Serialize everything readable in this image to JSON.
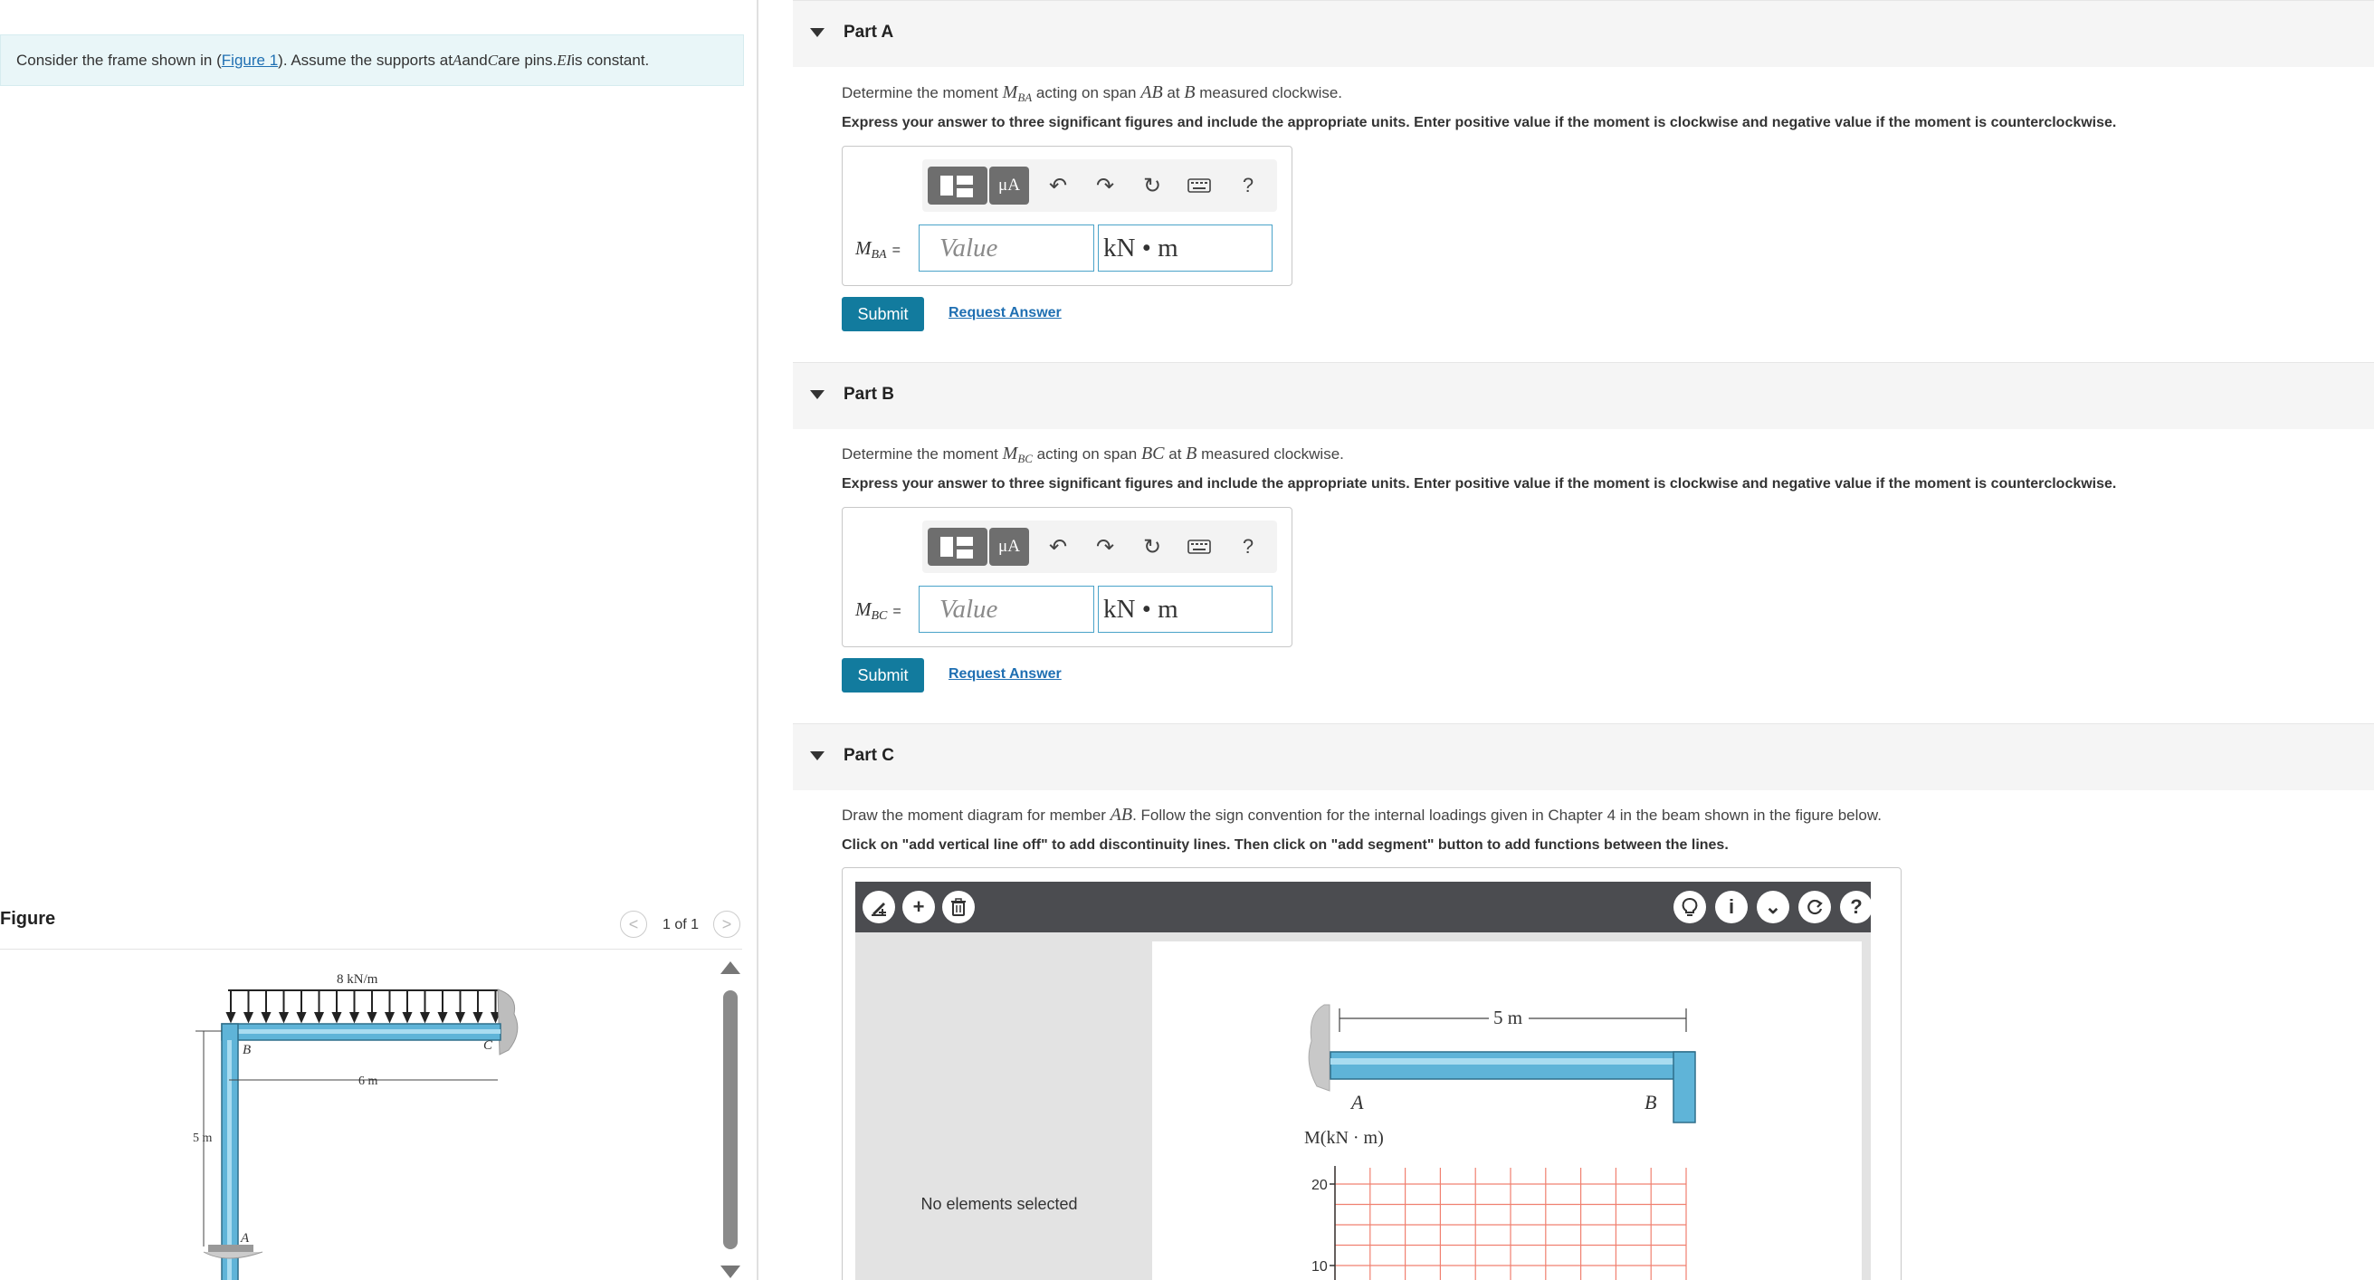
{
  "problem": {
    "text_before_link": "Consider the frame shown in (",
    "link": "Figure 1",
    "text_after_link": "). Assume the supports at ",
    "sym_a": "A",
    "and": " and ",
    "sym_c": "C",
    "are_pins": " are pins. ",
    "sym_ei": "EI",
    "is_constant": " is constant."
  },
  "figure": {
    "title": "Figure",
    "prev_icon": "<",
    "count": "1 of 1",
    "next_icon": ">",
    "load_label": "8 kN/m",
    "span_label": "6 m",
    "height_label": "5 m",
    "label_a": "A",
    "label_b": "B",
    "label_c": "C"
  },
  "parts": {
    "a": {
      "label": "Part A",
      "q_pre": "Determine the moment ",
      "q_sym": "M",
      "q_sub": "BA",
      "q_mid": " acting on span ",
      "q_span": "AB",
      "q_at": " at ",
      "q_pt": "B",
      "q_post": " measured clockwise.",
      "instruction": "Express your answer to three significant figures and include the appropriate units. Enter positive value if the moment is clockwise and negative value if the moment is counterclockwise.",
      "ans_sym": "M",
      "ans_sub": "BA",
      "eq": "=",
      "placeholder": "Value",
      "units": "kN • m",
      "submit": "Submit",
      "request": "Request Answer"
    },
    "b": {
      "label": "Part B",
      "q_pre": "Determine the moment ",
      "q_sym": "M",
      "q_sub": "BC",
      "q_mid": " acting on span ",
      "q_span": "BC",
      "q_at": " at ",
      "q_pt": "B",
      "q_post": " measured clockwise.",
      "instruction": "Express your answer to three significant figures and include the appropriate units. Enter positive value if the moment is clockwise and negative value if the moment is counterclockwise.",
      "ans_sym": "M",
      "ans_sub": "BC",
      "eq": "=",
      "placeholder": "Value",
      "units": "kN • m",
      "submit": "Submit",
      "request": "Request Answer"
    },
    "c": {
      "label": "Part C",
      "q_pre": "Draw the moment diagram for member ",
      "q_span": "AB",
      "q_post": ". Follow the sign convention for the internal loadings given in Chapter 4 in the beam shown in the figure below.",
      "instruction": "Click on \"add vertical line off\" to add discontinuity lines. Then click on \"add segment\" button to add functions between the lines.",
      "no_selection": "No elements selected",
      "beam_length": "5 m",
      "label_a": "A",
      "label_b": "B",
      "axis_label": "M(kN · m)",
      "tick_20": "20",
      "tick_10": "10"
    }
  },
  "toolbar": {
    "units_glyph": "μA",
    "undo": "↶",
    "redo": "↷",
    "reset": "↻",
    "help": "?"
  },
  "graph_toolbar": {
    "add": "+",
    "info": "i",
    "more": "⌄",
    "help": "?"
  },
  "colors": {
    "accent": "#127b9e",
    "link": "#1f6fb2",
    "problem_bg": "#e9f6f8",
    "grid": "#f08070",
    "beam": "#5fb4d8"
  }
}
